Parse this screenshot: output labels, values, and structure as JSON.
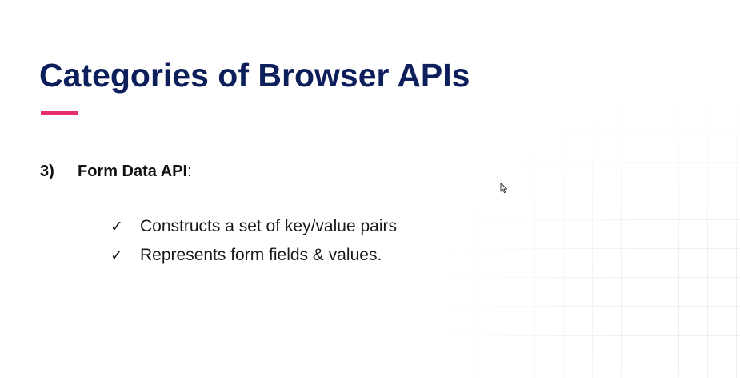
{
  "slide": {
    "title": "Categories of Browser APIs",
    "accent_color": "#e52d6f",
    "title_color": "#0c1f5b",
    "section": {
      "number": "3)",
      "name": "Form Data API",
      "suffix": ":"
    },
    "bullets": [
      {
        "icon": "checkmark-icon",
        "text": "Constructs a set of key/value pairs"
      },
      {
        "icon": "checkmark-icon",
        "text": "Represents form fields & values."
      }
    ]
  },
  "cursor": {
    "icon": "mouse-pointer-icon"
  }
}
